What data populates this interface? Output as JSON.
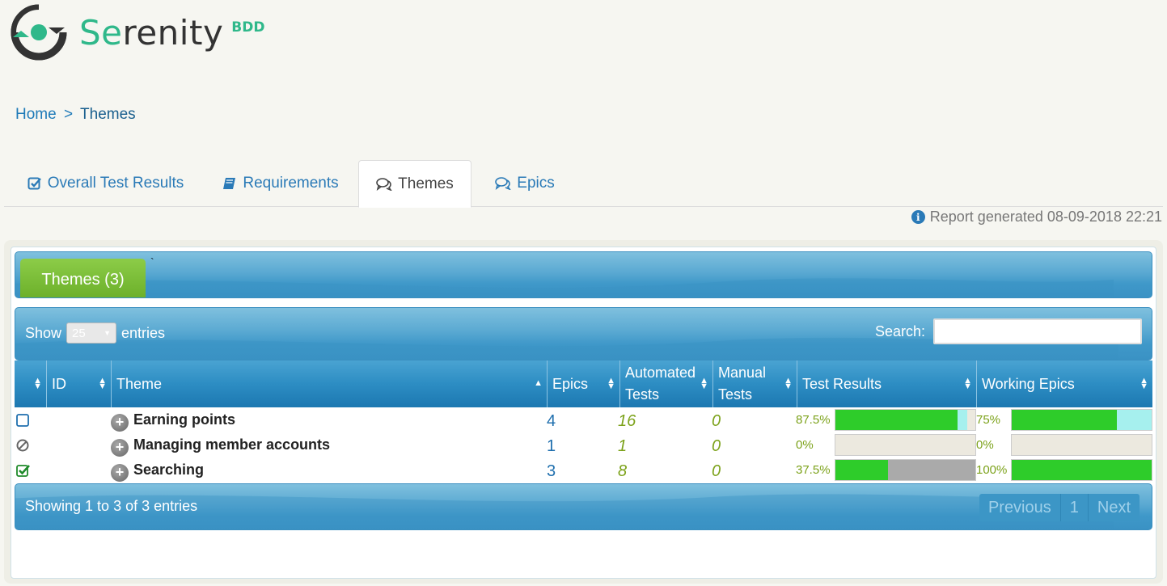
{
  "brand": {
    "name_se": "Se",
    "name_rest": "renity",
    "suffix": "BDD"
  },
  "breadcrumb": {
    "home": "Home",
    "separator": ">",
    "current": "Themes"
  },
  "tabs": [
    {
      "label": "Overall Test Results",
      "icon": "check-square-icon"
    },
    {
      "label": "Requirements",
      "icon": "book-icon"
    },
    {
      "label": "Themes",
      "icon": "comments-icon",
      "active": true
    },
    {
      "label": "Epics",
      "icon": "comments-icon"
    }
  ],
  "report": {
    "generated_text": "Report generated 08-09-2018 22:21"
  },
  "panel": {
    "tab_label": "Themes (3)",
    "tick": "`"
  },
  "table": {
    "show_label": "Show",
    "show_value": "25",
    "entries_label": "entries",
    "search_label": "Search:",
    "columns": [
      "",
      "ID",
      "Theme",
      "Epics",
      "Automated Tests",
      "Manual Tests",
      "Test Results",
      "Working Epics"
    ],
    "rows": [
      {
        "status": "pending",
        "theme": "Earning points",
        "epics": "4",
        "automated": "16",
        "manual": "0",
        "test_pct": "87.5%",
        "test_pass": 87.5,
        "test_pending": 6.5,
        "epic_pct": "75%",
        "epic_pass": 75
      },
      {
        "status": "ignored",
        "theme": "Managing member accounts",
        "epics": "1",
        "automated": "1",
        "manual": "0",
        "test_pct": "0%",
        "test_pass": 0,
        "test_pending": 0,
        "epic_pct": "0%",
        "epic_pass": 0
      },
      {
        "status": "passed",
        "theme": "Searching",
        "epics": "3",
        "automated": "8",
        "manual": "0",
        "test_pct": "37.5%",
        "test_pass": 37.5,
        "test_pending": 62.5,
        "epic_pct": "100%",
        "epic_pass": 100
      }
    ],
    "info": "Showing 1 to 3 of 3 entries",
    "pager": {
      "previous": "Previous",
      "page": "1",
      "next": "Next"
    }
  },
  "colors": {
    "accent": "#2fb88a",
    "link": "#1e7ab8",
    "pass": "#2ecc2a",
    "pending": "#a6f0ee",
    "skipped": "#aaaaaa"
  }
}
